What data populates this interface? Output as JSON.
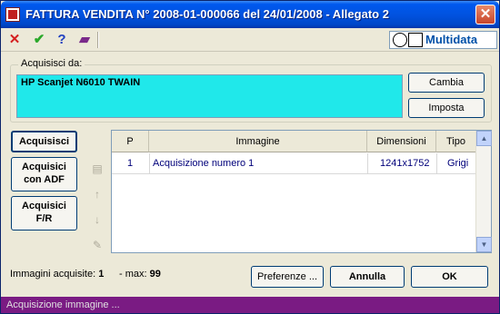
{
  "window": {
    "title": "FATTURA VENDITA N° 2008-01-000066 del 24/01/2008 - Allegato 2",
    "close": "✕"
  },
  "toolbar": {
    "icons": [
      "close-red-x",
      "check-green",
      "help-question",
      "book"
    ],
    "glyphs": {
      "close": "✕",
      "check": "✔",
      "help": "?",
      "book": "▰"
    },
    "logo_text": "Multidata"
  },
  "source": {
    "group_label": "Acquisisci da:",
    "scanner_name": "HP Scanjet N6010 TWAIN",
    "scanner_bg": "#20e8ea",
    "change_label": "Cambia",
    "setup_label": "Imposta"
  },
  "actions": {
    "acquire_label": "Acquisisci",
    "acquire_adf_line1": "Acquisici",
    "acquire_adf_line2": "con ADF",
    "acquire_fr_line1": "Acquisici",
    "acquire_fr_line2": "F/R"
  },
  "side_icons": [
    "document-icon",
    "arrow-up-icon",
    "arrow-down-icon",
    "edit-icon"
  ],
  "table": {
    "columns": [
      "P",
      "Immagine",
      "Dimensioni",
      "Tipo"
    ],
    "rows": [
      {
        "p": "1",
        "immagine": "Acquisizione numero 1",
        "dimensioni": "1241x1752",
        "tipo": "Grigi"
      }
    ]
  },
  "footer": {
    "acquired_label": "Immagini acquisite:",
    "acquired_count": "1",
    "max_label": "- max:",
    "max_value": "99",
    "preferences_label": "Preferenze ...",
    "cancel_label": "Annulla",
    "ok_label": "OK"
  },
  "status": {
    "text": "Acquisizione immagine ...",
    "color": "#7a1b83"
  }
}
